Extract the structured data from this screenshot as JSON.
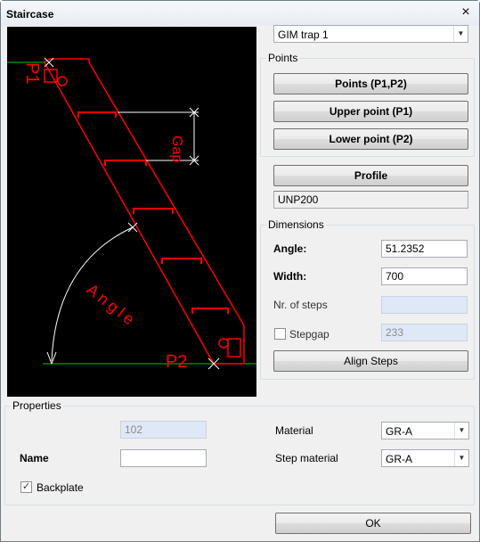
{
  "window": {
    "title": "Staircase",
    "close_glyph": "×"
  },
  "profile_select": {
    "value": "GIM trap 1"
  },
  "points": {
    "group_label": "Points",
    "btn_p1p2": "Points (P1,P2)",
    "btn_upper": "Upper point (P1)",
    "btn_lower": "Lower point (P2)"
  },
  "profile": {
    "button_label": "Profile",
    "value": "UNP200"
  },
  "dimensions": {
    "group_label": "Dimensions",
    "angle_label": "Angle:",
    "angle_value": "51.2352",
    "width_label": "Width:",
    "width_value": "700",
    "steps_label": "Nr. of steps",
    "steps_value": "",
    "stepgap_label": "Stepgap",
    "stepgap_checked": false,
    "stepgap_value": "233",
    "align_button": "Align Steps"
  },
  "properties": {
    "group_label": "Properties",
    "id_value": "102",
    "name_label": "Name",
    "name_value": "",
    "backplate_label": "Backplate",
    "backplate_checked": true,
    "material_label": "Material",
    "material_value": "GR-A",
    "step_material_label": "Step material",
    "step_material_value": "GR-A"
  },
  "footer": {
    "ok_label": "OK"
  },
  "diagram": {
    "label_p1": "P1",
    "label_p2": "P2",
    "label_gap": "Gap",
    "label_angle": "Angle",
    "colors": {
      "stair": "#ff0000",
      "ground": "#00c800",
      "dim": "#ffffff",
      "bg": "#000000"
    }
  }
}
